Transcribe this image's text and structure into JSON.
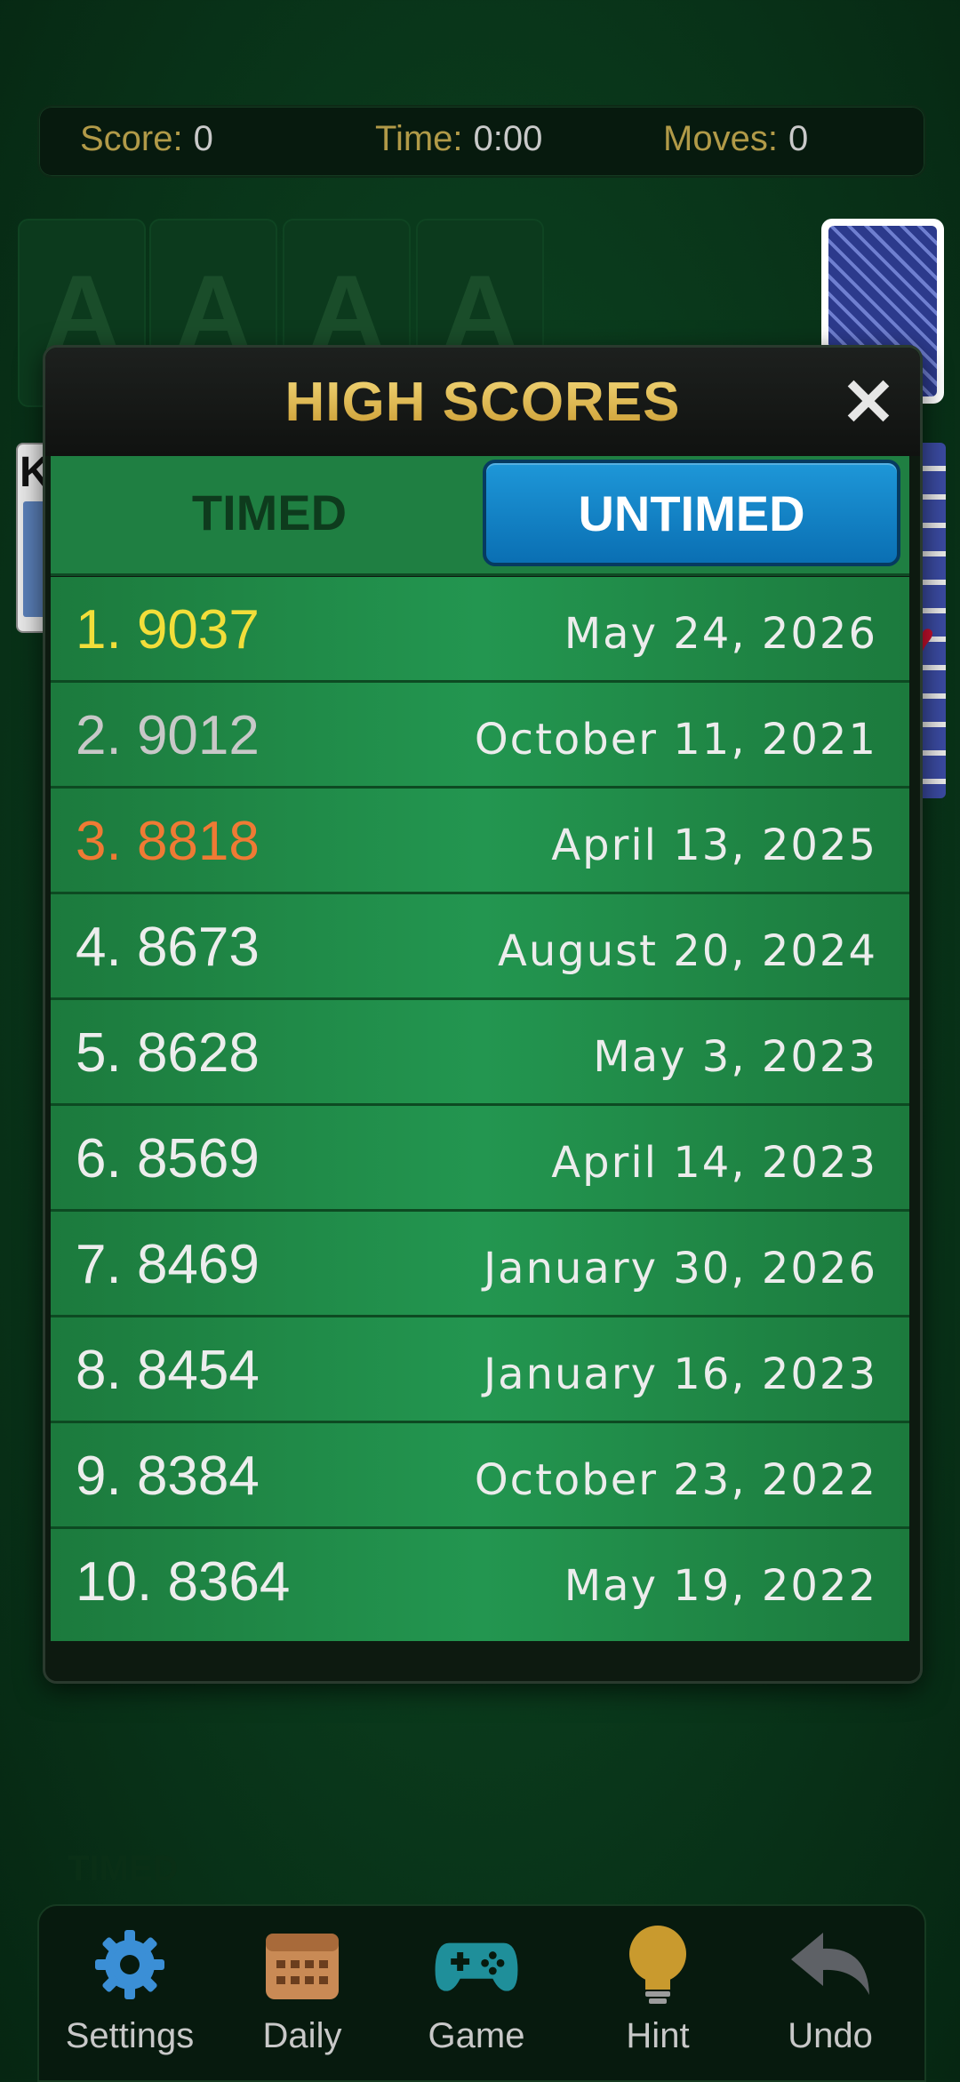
{
  "stats": {
    "score_label": "Score:",
    "score_value": "0",
    "time_label": "Time:",
    "time_value": "0:00",
    "moves_label": "Moves:",
    "moves_value": "0"
  },
  "foundations": [
    "A",
    "A",
    "A",
    "A"
  ],
  "tableau_left_card": "K",
  "modal": {
    "title": "HIGH SCORES",
    "close_label": "✕",
    "tabs": [
      {
        "label": "TIMED",
        "active": false
      },
      {
        "label": "UNTIMED",
        "active": true
      }
    ],
    "scores": [
      {
        "rank": "1.",
        "score": "9037",
        "date": "May 24, 2026"
      },
      {
        "rank": "2.",
        "score": "9012",
        "date": "October 11, 2021"
      },
      {
        "rank": "3.",
        "score": "8818",
        "date": "April 13, 2025"
      },
      {
        "rank": "4.",
        "score": "8673",
        "date": "August 20, 2024"
      },
      {
        "rank": "5.",
        "score": "8628",
        "date": "May 3, 2023"
      },
      {
        "rank": "6.",
        "score": "8569",
        "date": "April 14, 2023"
      },
      {
        "rank": "7.",
        "score": "8469",
        "date": "January 30, 2026"
      },
      {
        "rank": "8.",
        "score": "8454",
        "date": "January 16, 2023"
      },
      {
        "rank": "9.",
        "score": "8384",
        "date": "October 23, 2022"
      },
      {
        "rank": "10.",
        "score": "8364",
        "date": "May 19, 2022"
      }
    ]
  },
  "ghost_label": "TIMED",
  "nav": {
    "settings": {
      "label": "Settings",
      "icon": "gear-icon"
    },
    "daily": {
      "label": "Daily",
      "icon": "calendar-icon"
    },
    "game": {
      "label": "Game",
      "icon": "gamepad-icon"
    },
    "hint": {
      "label": "Hint",
      "icon": "lightbulb-icon"
    },
    "undo": {
      "label": "Undo",
      "icon": "undo-arrow-icon"
    }
  },
  "colors": {
    "gold": "#f2de3a",
    "silver": "#c8c8c8",
    "bronze": "#ef7a34",
    "accent_tab": "#1e97d8",
    "felt": "#0a3a1c"
  }
}
